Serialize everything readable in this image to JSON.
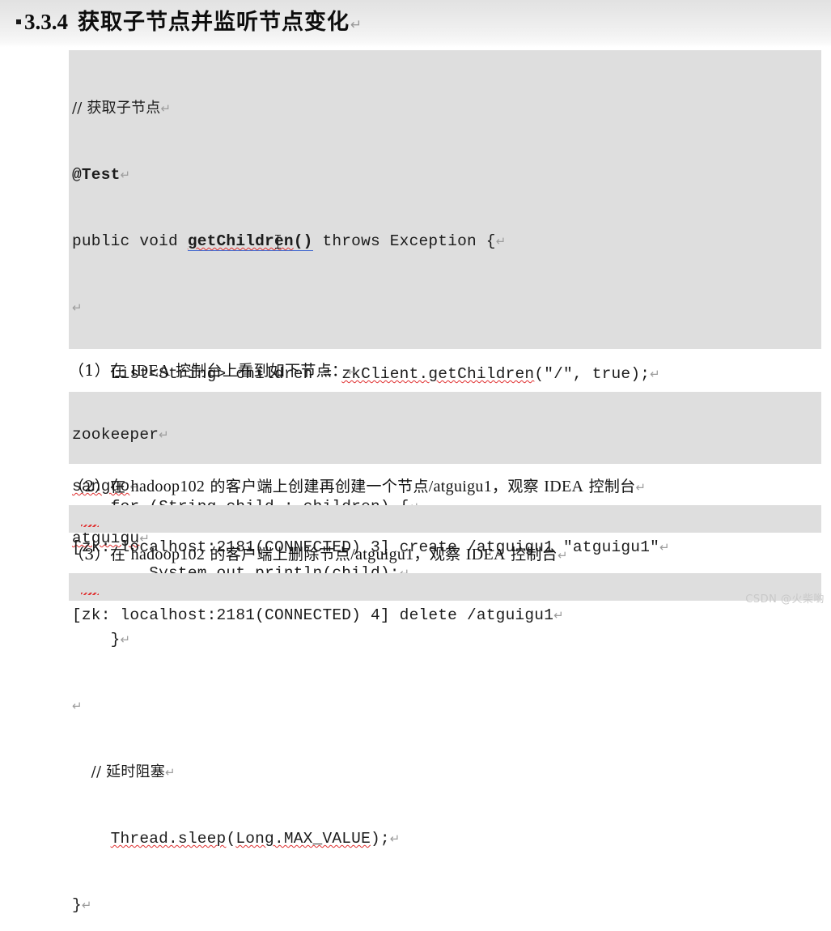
{
  "document": {
    "heading": {
      "bullet": "▪",
      "number": "3.3.4",
      "title": "获取子节点并监听节点变化",
      "pilcrow": "↵"
    },
    "watermark": "CSDN @火柴喲"
  },
  "code_block_1": {
    "lines": [
      {
        "id": "c1l1",
        "text": "// 获取子节点"
      },
      {
        "id": "c1l2",
        "text": "@Test"
      },
      {
        "id": "c1l3a",
        "text": "public void "
      },
      {
        "id": "c1l3b",
        "text": "getChildren"
      },
      {
        "id": "c1l3c",
        "text": "()"
      },
      {
        "id": "c1l3d",
        "text": " throws Exception {"
      },
      {
        "id": "c1l4",
        "text": ""
      },
      {
        "id": "c1l5a",
        "text": "    List<String> children = "
      },
      {
        "id": "c1l5b",
        "text": "zkClient.getChildren"
      },
      {
        "id": "c1l5c",
        "text": "(\"/\", true);"
      },
      {
        "id": "c1l6",
        "text": ""
      },
      {
        "id": "c1l7a",
        "text": "    for (String "
      },
      {
        "id": "c1l7b",
        "text": "child :"
      },
      {
        "id": "c1l7c",
        "text": " children) {"
      },
      {
        "id": "c1l8a",
        "text": "        "
      },
      {
        "id": "c1l8b",
        "text": "System.out.println"
      },
      {
        "id": "c1l8c",
        "text": "(child);"
      },
      {
        "id": "c1l9",
        "text": "    }"
      },
      {
        "id": "c1l10",
        "text": ""
      },
      {
        "id": "c1l11",
        "text": "    // 延时阻塞"
      },
      {
        "id": "c1l12a",
        "text": "    "
      },
      {
        "id": "c1l12b",
        "text": "Thread.sleep"
      },
      {
        "id": "c1l12c",
        "text": "("
      },
      {
        "id": "c1l12d",
        "text": "Long.MAX_VALUE"
      },
      {
        "id": "c1l12e",
        "text": ");"
      },
      {
        "id": "c1l13",
        "text": "}"
      }
    ]
  },
  "paragraph_1": {
    "prefix": "（1）在 ",
    "latin": "IDEA",
    "suffix": " 控制台上看到如下节点：",
    "pilcrow": "↵"
  },
  "code_block_2": {
    "lines": [
      {
        "id": "c2l1",
        "text": "zookeeper"
      },
      {
        "id": "c2l2",
        "text": "sanguo"
      },
      {
        "id": "c2l3",
        "text": "atguigu"
      }
    ]
  },
  "paragraph_2": {
    "prefix": "（2）在 ",
    "host": "hadoop102",
    "middle": " 的客户端上创建再创建一个节点",
    "path": "/atguigu1",
    "comma": "，观察 ",
    "ide": "IDEA",
    "suffix": " 控制台",
    "pilcrow": "↵"
  },
  "code_block_3": {
    "line": "[zk: localhost:2181(CONNECTED) 3] create /atguigu1 \"atguigu1\"",
    "spell_word": "zk",
    "pilcrow": "↵"
  },
  "paragraph_3": {
    "prefix": "（3）在 ",
    "host": "hadoop102",
    "middle": " 的客户端上删除节点",
    "path": "/atguigu1",
    "comma": "，观察 ",
    "ide": "IDEA",
    "suffix": " 控制台",
    "pilcrow": "↵"
  },
  "code_block_4": {
    "line": "[zk: localhost:2181(CONNECTED) 4] delete /atguigu1",
    "spell_word": "zk",
    "pilcrow": "↵"
  },
  "colors": {
    "code_background": "#dedede",
    "page_background": "#ffffff",
    "text": "#1c1c1c",
    "spellcheck_underline": "#e03030",
    "reference_underline": "#3a62c8",
    "pilcrow": "#9d9d9d",
    "watermark": "#c9c9c9"
  }
}
